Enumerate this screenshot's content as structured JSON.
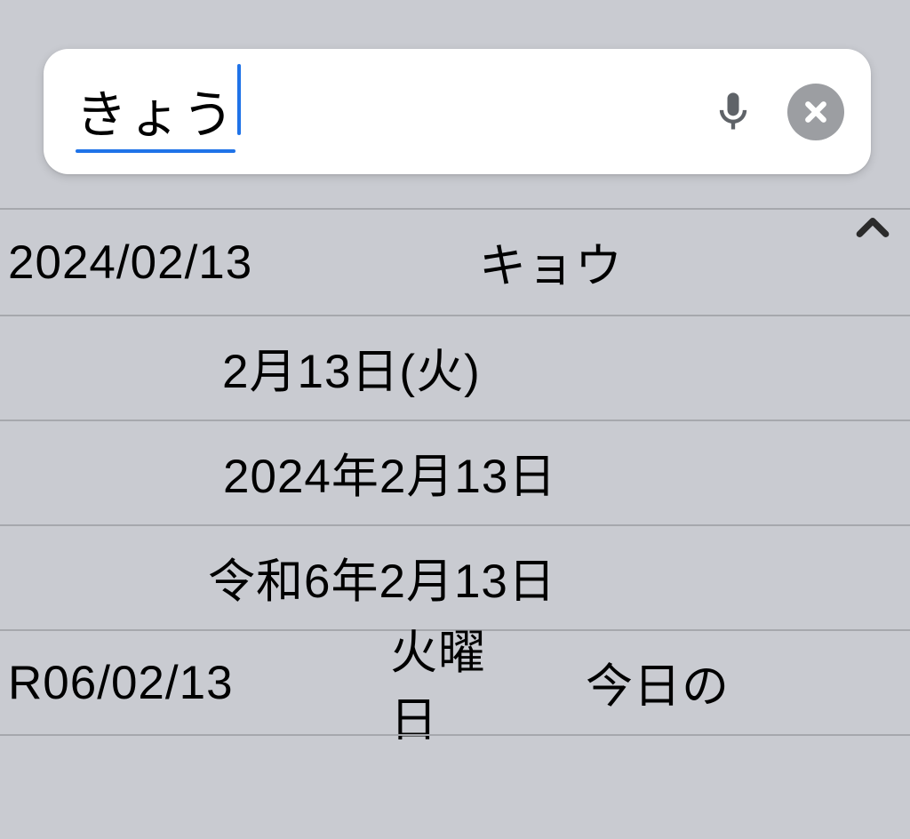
{
  "search": {
    "value": "きょう"
  },
  "candidates": {
    "row1": {
      "left": "2024/02/13",
      "right": "キョウ"
    },
    "row2": "2月13日(火)",
    "row3": "2024年2月13日",
    "row4": "令和6年2月13日",
    "row5": {
      "c1": "R06/02/13",
      "c2": "火曜日",
      "c3": "今日の"
    }
  }
}
